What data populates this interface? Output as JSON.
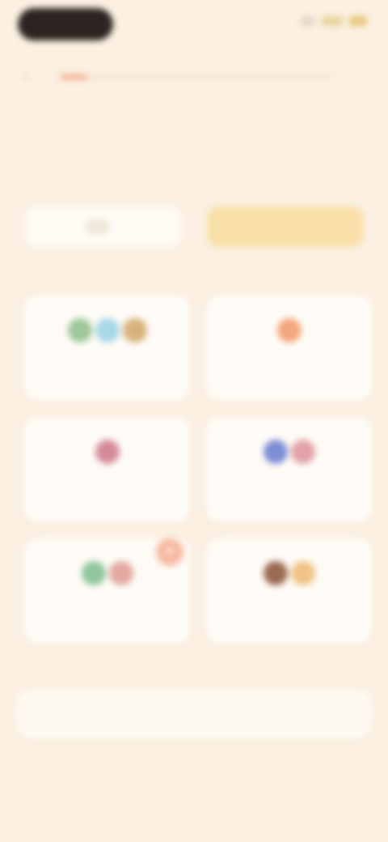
{
  "header": {
    "back_icon": "chevron-left-icon",
    "progress_fraction": 0.1
  },
  "colors": {
    "background": "#fbf0e2",
    "accent_yellow": "#f9dfa8",
    "progress_fill": "#f4a88b",
    "card_bg": "#fefbf6"
  },
  "grid": {
    "cards": [
      {
        "flag_colors": [
          "#9ec79a",
          "#a7d8e8",
          "#d8b27a"
        ]
      },
      {
        "flag_colors": [
          "#f2a77f"
        ]
      },
      {
        "flag_colors": [
          "#d58a9a"
        ]
      },
      {
        "flag_colors": [
          "#7d8ed6",
          "#e2a2a8"
        ]
      },
      {
        "flag_colors": [
          "#8fc79b",
          "#e4a8a0"
        ]
      },
      {
        "flag_colors": [
          "#9a6a52",
          "#f0c486"
        ]
      }
    ]
  },
  "bubble": {
    "icon": "sparkle-icon"
  }
}
